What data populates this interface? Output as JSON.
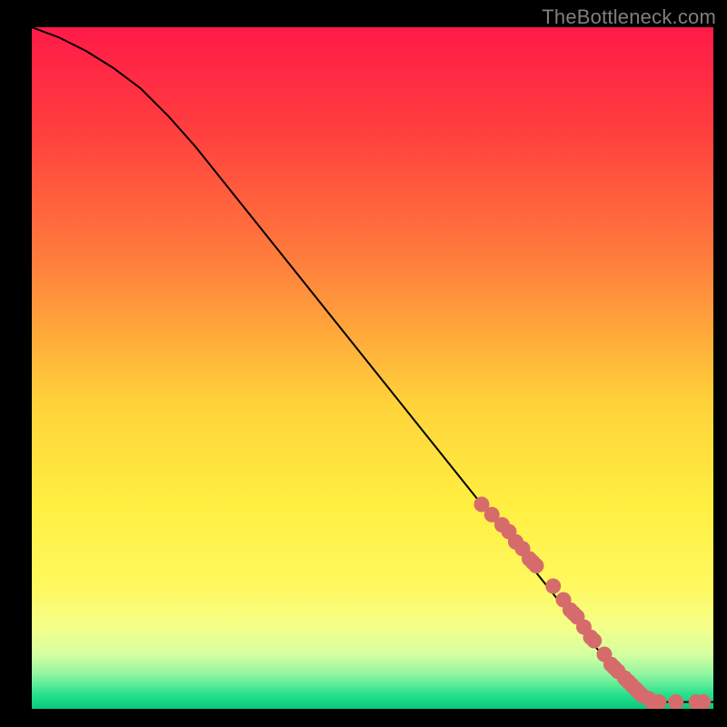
{
  "watermark": "TheBottleneck.com",
  "chart_data": {
    "type": "line",
    "title": "",
    "xlabel": "",
    "ylabel": "",
    "xlim": [
      0,
      100
    ],
    "ylim": [
      0,
      100
    ],
    "series": [
      {
        "name": "curve",
        "x": [
          0,
          4,
          8,
          12,
          16,
          20,
          24,
          28,
          32,
          36,
          40,
          44,
          48,
          52,
          56,
          60,
          64,
          68,
          72,
          76,
          80,
          82,
          84,
          86,
          88,
          90,
          92,
          94,
          96,
          98,
          100
        ],
        "y": [
          100,
          98.5,
          96.5,
          94,
          91,
          87,
          82.5,
          77.5,
          72.5,
          67.5,
          62.5,
          57.5,
          52.5,
          47.5,
          42.5,
          37.5,
          32.5,
          27.5,
          22.5,
          17.5,
          12.5,
          10,
          7.5,
          5,
          3,
          1.5,
          1,
          1,
          1,
          1,
          1
        ]
      },
      {
        "name": "markers",
        "x": [
          66,
          67.5,
          69,
          70,
          71,
          72,
          73,
          73.5,
          74,
          76.5,
          78,
          79,
          79.5,
          80,
          81,
          82,
          82.5,
          84,
          85,
          85.5,
          86,
          87,
          87.5,
          88,
          88.5,
          89,
          89.5,
          90.5,
          91,
          92,
          94.5,
          97.5,
          98.5
        ],
        "y": [
          30,
          28.5,
          27,
          26,
          24.5,
          23.5,
          22,
          21.5,
          21,
          18,
          16,
          14.5,
          14,
          13.5,
          12,
          10.5,
          10,
          8,
          6.5,
          6,
          5.5,
          4.5,
          4,
          3.5,
          3,
          2.5,
          2,
          1.5,
          1,
          1,
          1,
          1,
          1
        ]
      }
    ],
    "marker_color": "#d66b6b",
    "curve_color": "#000000",
    "gradient_stops": [
      {
        "offset": 0,
        "color": "#ff1a48"
      },
      {
        "offset": 15,
        "color": "#ff3e3e"
      },
      {
        "offset": 35,
        "color": "#ff803c"
      },
      {
        "offset": 55,
        "color": "#ffd23a"
      },
      {
        "offset": 70,
        "color": "#ffef41"
      },
      {
        "offset": 82,
        "color": "#fff85f"
      },
      {
        "offset": 88,
        "color": "#f4ff8a"
      },
      {
        "offset": 92,
        "color": "#d6ffa0"
      },
      {
        "offset": 95,
        "color": "#90f5a0"
      },
      {
        "offset": 98,
        "color": "#25e08d"
      },
      {
        "offset": 100,
        "color": "#08c97d"
      }
    ]
  }
}
